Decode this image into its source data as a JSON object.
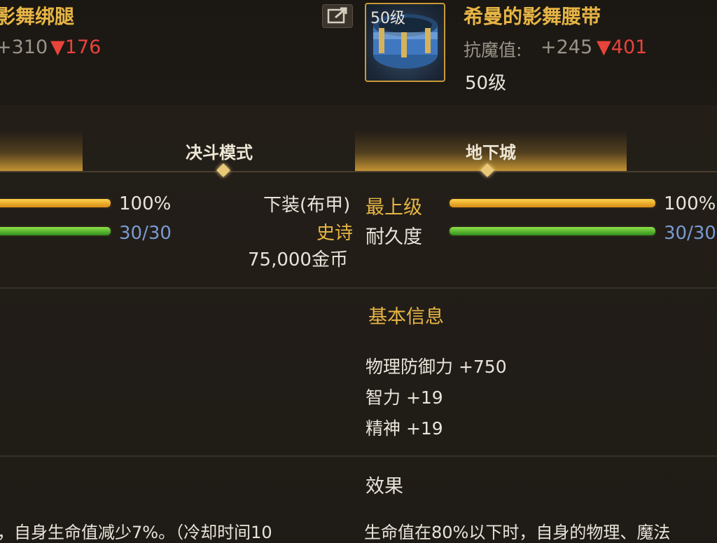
{
  "left_item": {
    "name": "影舞绑腿",
    "stat_change": "+310",
    "stat_delta": "▼176"
  },
  "right_item": {
    "level_badge": "50级",
    "name": "希曼的影舞腰带",
    "stat_label": "抗魔值:",
    "stat_change": "+245",
    "stat_delta": "▼401",
    "level": "50级"
  },
  "tabs": [
    {
      "label": "决斗模式"
    },
    {
      "label": "地下城"
    }
  ],
  "left_status": {
    "grade_percent": "100%",
    "grade_fraction": 1.0,
    "durability": "30/30",
    "durability_fraction": 1.0,
    "type": "下装(布甲)",
    "rarity": "史诗",
    "price": "75,000金币"
  },
  "right_status": {
    "grade_label": "最上级",
    "grade_percent": "100%",
    "grade_fraction": 1.0,
    "durability_label": "耐久度",
    "durability": "30/30",
    "durability_fraction": 1.0
  },
  "basic_info": {
    "title": "基本信息",
    "stats": [
      "物理防御力 +750",
      "智力 +19",
      "精神 +19"
    ]
  },
  "effect": {
    "title": "效果",
    "left_text": "，自身生命值减少7%。（冷却时间10",
    "right_text": "生命值在80%以下时，自身的物理、魔法"
  },
  "colors": {
    "gold": "#e7b544",
    "red": "#e8443a",
    "blue": "#7a9ad2"
  }
}
